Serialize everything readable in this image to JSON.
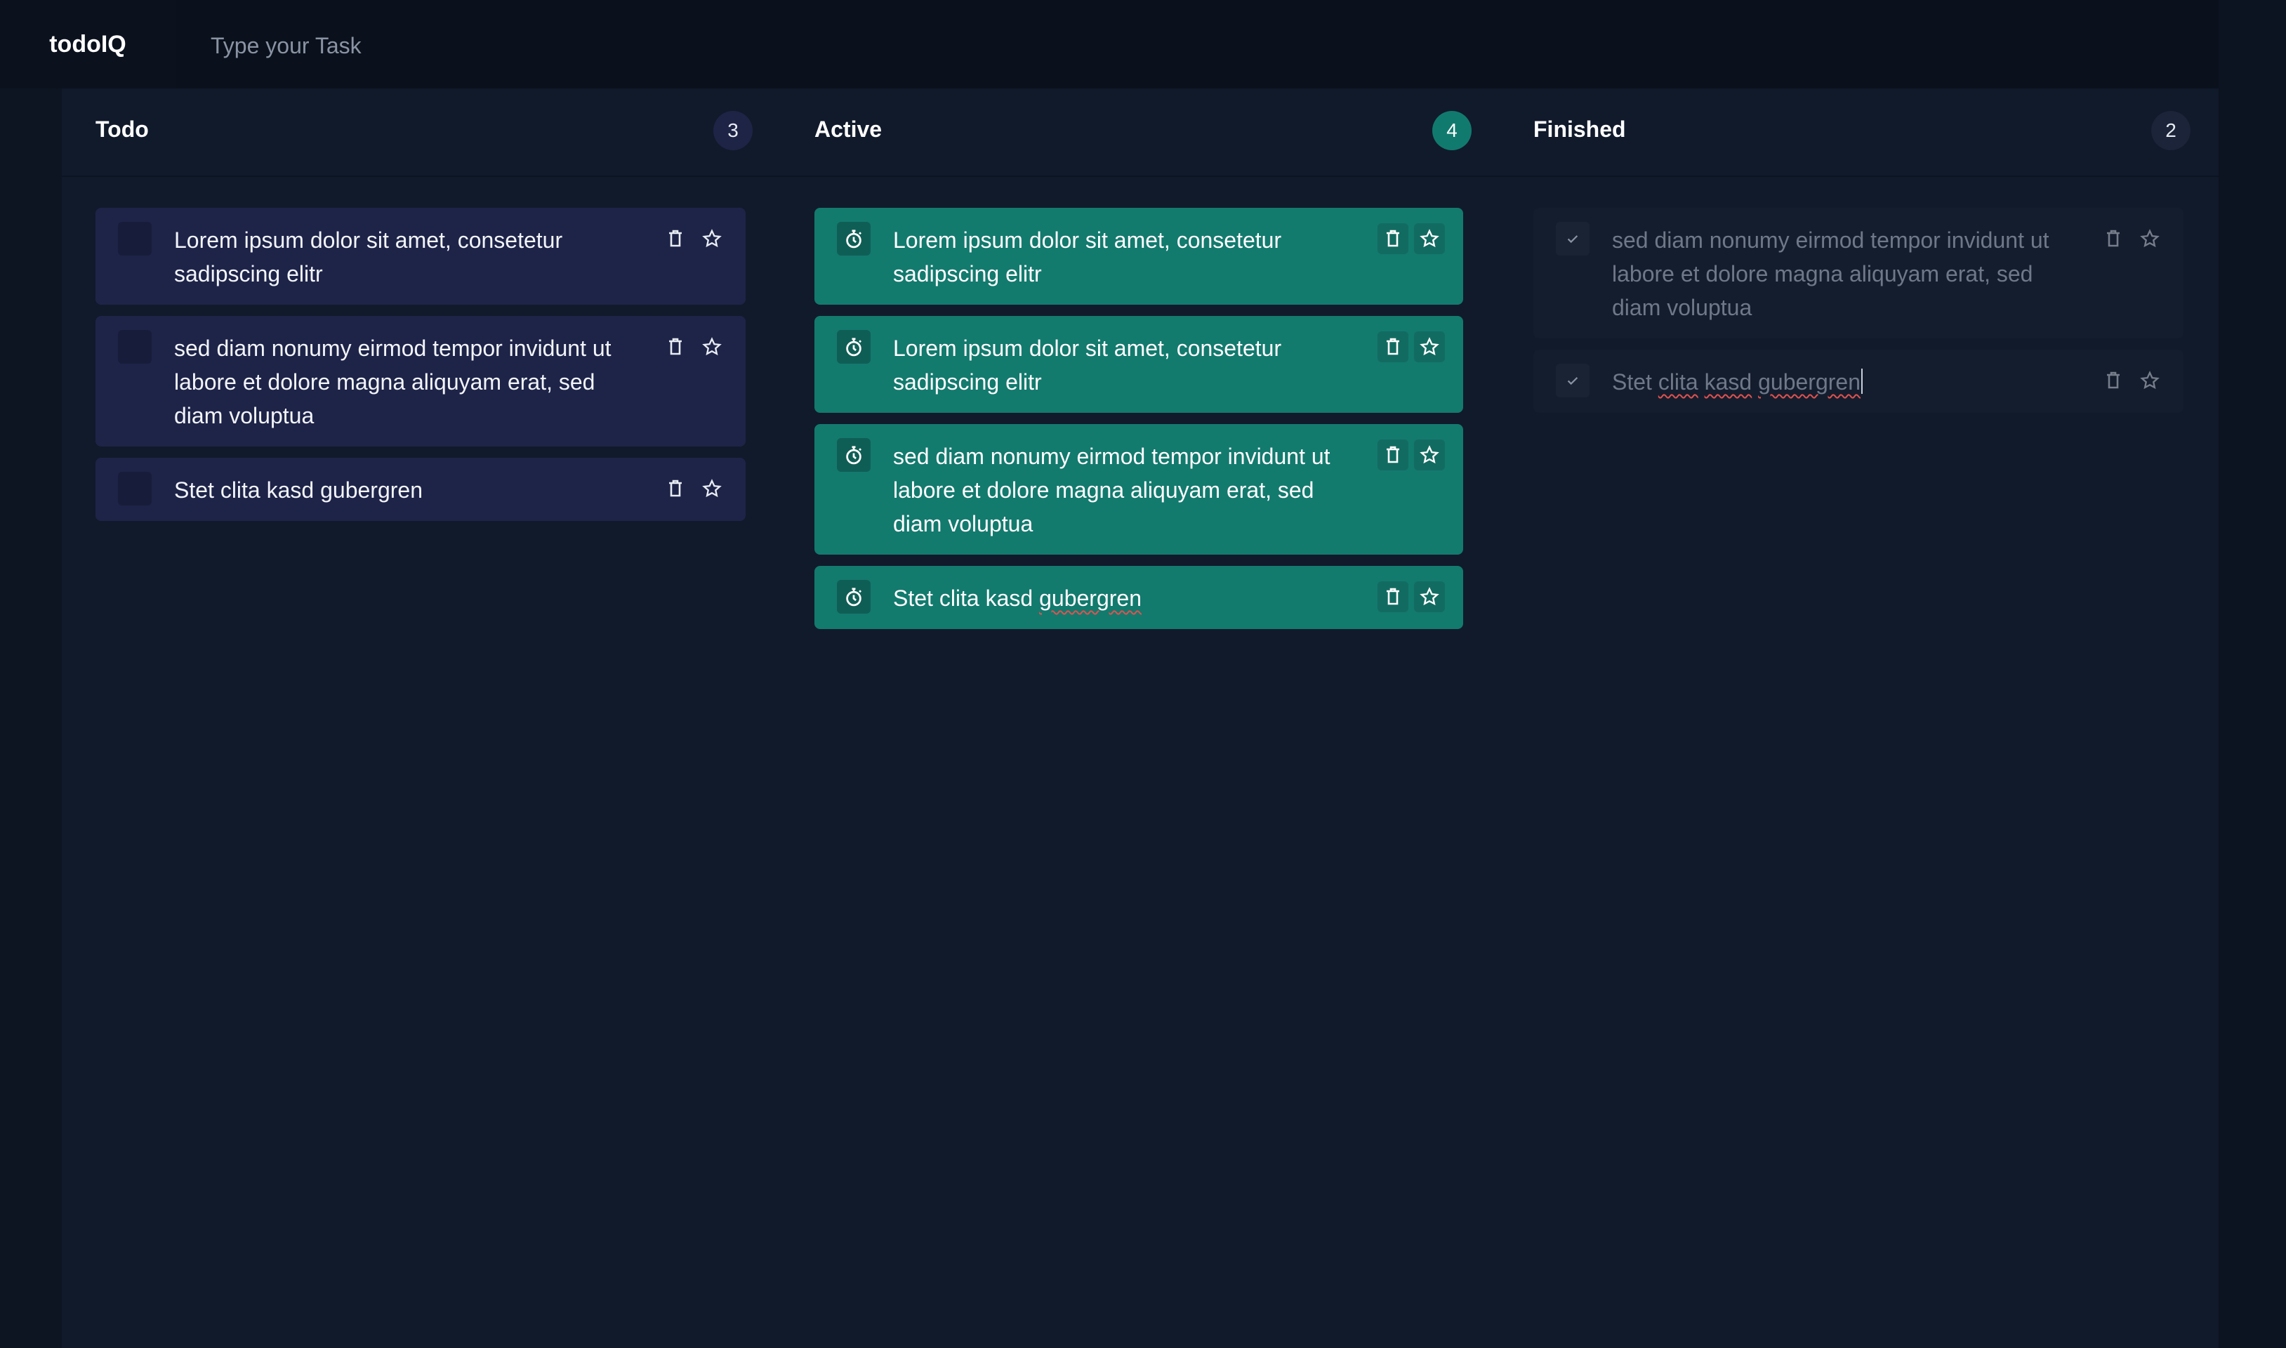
{
  "app": {
    "title": "todoIQ"
  },
  "search": {
    "placeholder": "Type your Task"
  },
  "columns": {
    "todo": {
      "title": "Todo",
      "count": "3",
      "cards": [
        {
          "text": "Lorem ipsum dolor sit amet, consetetur sadipscing elitr"
        },
        {
          "text": "sed diam nonumy eirmod tempor invidunt ut labore et dolore magna aliquyam erat, sed diam voluptua"
        },
        {
          "text": "Stet clita kasd gubergren"
        }
      ]
    },
    "active": {
      "title": "Active",
      "count": "4",
      "cards": [
        {
          "text": "Lorem ipsum dolor sit amet, consetetur sadipscing elitr"
        },
        {
          "text": "Lorem ipsum dolor sit amet, consetetur sadipscing elitr"
        },
        {
          "text": "sed diam nonumy eirmod tempor invidunt ut labore et dolore magna aliquyam erat, sed diam voluptua"
        },
        {
          "text_prefix": "Stet clita kasd ",
          "text_flagged": "gubergren"
        }
      ]
    },
    "finished": {
      "title": "Finished",
      "count": "2",
      "cards": [
        {
          "text": "sed diam nonumy eirmod tempor invidunt ut labore et dolore magna aliquyam erat, sed diam voluptua"
        },
        {
          "text_prefix": "Stet ",
          "text_flagged_1": "clita",
          "text_space_1": " ",
          "text_flagged_2": "kasd",
          "text_space_2": " ",
          "text_flagged_3": "gubergren"
        }
      ]
    }
  },
  "icons": {
    "delete": "trash-icon",
    "favorite": "star-icon",
    "timer": "stopwatch-icon",
    "done": "check-icon"
  },
  "colors": {
    "background": "#0f1726",
    "todo_card": "#1e2448",
    "active_card": "#137a6e",
    "finished_card": "#141d2d",
    "active_badge": "#117a6e"
  }
}
